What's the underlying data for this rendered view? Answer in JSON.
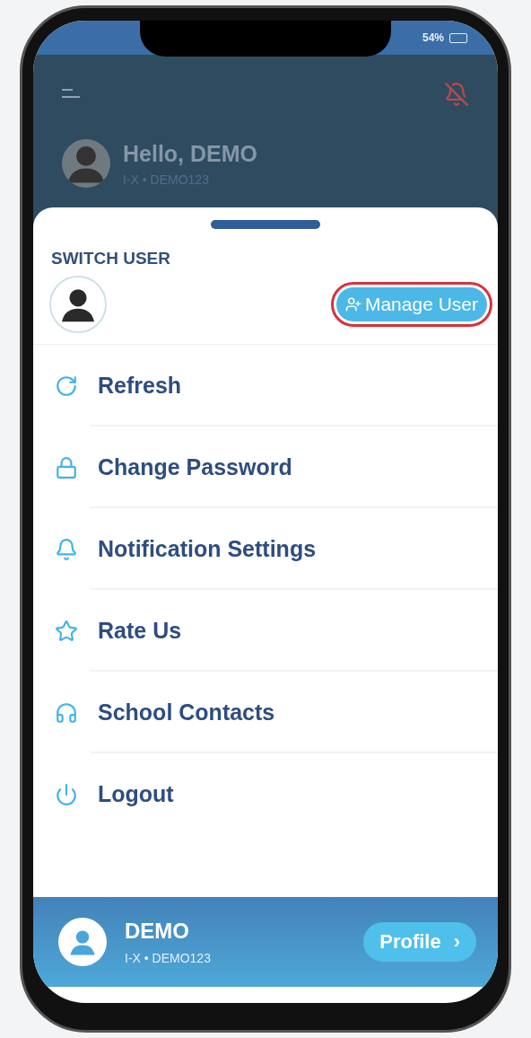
{
  "status_bar": {
    "battery": "54%"
  },
  "header": {
    "greeting": "Hello, DEMO",
    "subtitle": "I-X  •  DEMO123"
  },
  "sheet": {
    "title": "SWITCH USER",
    "manage_user": {
      "label": "Manage User",
      "highlighted": true
    },
    "menu": [
      {
        "label": "Refresh"
      },
      {
        "label": "Change Password"
      },
      {
        "label": "Notification Settings"
      },
      {
        "label": "Rate Us"
      },
      {
        "label": "School Contacts"
      },
      {
        "label": "Logout"
      }
    ]
  },
  "footer": {
    "name": "DEMO",
    "subtitle": "I-X • DEMO123",
    "profile_button": "Profile",
    "chevron": "›"
  }
}
